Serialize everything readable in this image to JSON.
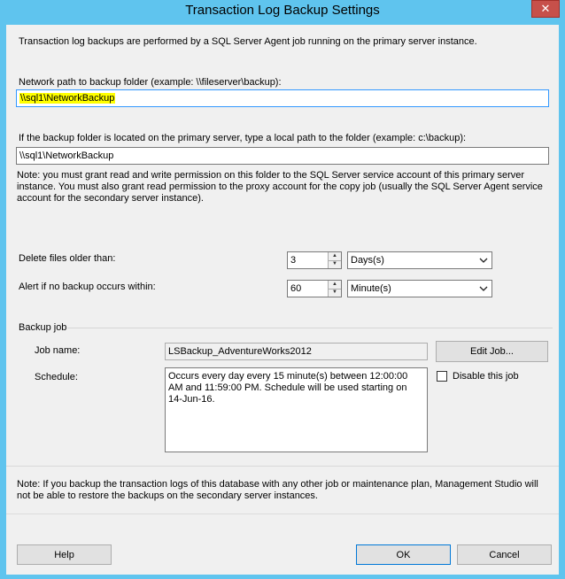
{
  "window": {
    "title": "Transaction Log Backup Settings",
    "close_glyph": "✕"
  },
  "intro": "Transaction log backups are performed by a SQL Server Agent job running on the primary server instance.",
  "network": {
    "label": "Network path to backup folder (example: \\\\fileserver\\backup):",
    "value": "\\\\sql1\\NetworkBackup"
  },
  "local": {
    "label": "If the backup folder is located on the primary server, type a local path to the folder (example: c:\\backup):",
    "value": "\\\\sql1\\NetworkBackup",
    "note": "Note: you must grant read and write permission on this folder to the SQL Server service account of this primary server instance. You must also grant read permission to the proxy account for the copy job (usually the SQL Server Agent service account for the secondary server instance)."
  },
  "delete_files": {
    "label": "Delete files older than:",
    "value": "3",
    "unit": "Days(s)"
  },
  "alert": {
    "label": "Alert if no backup occurs within:",
    "value": "60",
    "unit": "Minute(s)"
  },
  "backup_job": {
    "group_label": "Backup job",
    "job_name_label": "Job name:",
    "job_name": "LSBackup_AdventureWorks2012",
    "edit_label": "Edit Job...",
    "schedule_label": "Schedule:",
    "schedule": "Occurs every day every 15 minute(s) between 12:00:00 AM and 11:59:00 PM. Schedule will be used starting on 14-Jun-16.",
    "disable_label": "Disable this job"
  },
  "footer_note": "Note: If you backup the transaction logs of this database with any other job or maintenance plan, Management Studio will not be able to restore the backups on the secondary server instances.",
  "buttons": {
    "help": "Help",
    "ok": "OK",
    "cancel": "Cancel"
  },
  "icons": {
    "spin_up": "▲",
    "spin_down": "▼",
    "dropdown": "chevron-down-icon"
  }
}
